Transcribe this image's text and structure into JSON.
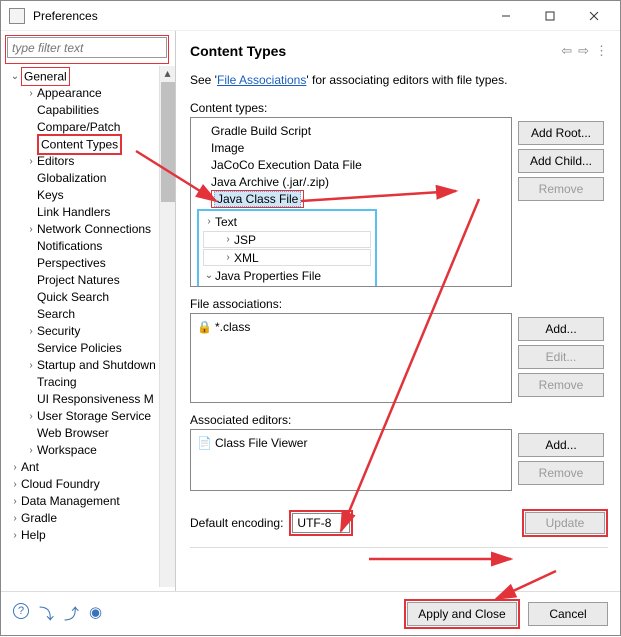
{
  "window": {
    "title": "Preferences"
  },
  "sidebar": {
    "filter_placeholder": "type filter text",
    "nodes": [
      {
        "label": "General",
        "expanded": true,
        "children": [
          "Appearance",
          "Capabilities",
          "Compare/Patch",
          "Content Types",
          "Editors",
          "Globalization",
          "Keys",
          "Link Handlers",
          "Network Connections",
          "Notifications",
          "Perspectives",
          "Project Natures",
          "Quick Search",
          "Search",
          "Security",
          "Service Policies",
          "Startup and Shutdown",
          "Tracing",
          "UI Responsiveness M",
          "User Storage Service",
          "Web Browser",
          "Workspace"
        ]
      },
      {
        "label": "Ant",
        "expanded": false
      },
      {
        "label": "Cloud Foundry",
        "expanded": false
      },
      {
        "label": "Data Management",
        "expanded": false
      },
      {
        "label": "Gradle",
        "expanded": false
      },
      {
        "label": "Help",
        "expanded": false
      }
    ],
    "selected_child": "Content Types"
  },
  "page": {
    "title": "Content Types",
    "intro_prefix": "See '",
    "intro_link": "File Associations",
    "intro_suffix": "' for associating editors with file types.",
    "content_types_label": "Content types:",
    "content_tree": {
      "items": [
        "Gradle Build Script",
        "Image",
        "JaCoCo Execution Data File",
        "Java Archive (.jar/.zip)",
        "Java Class File"
      ],
      "selected": "Java Class File",
      "text_node": {
        "label": "Text",
        "expanded": false,
        "children": [
          "JSP",
          "XML"
        ],
        "last": {
          "label": "Java Properties File",
          "expanded": true
        }
      }
    },
    "buttons_ct": {
      "add_root": "Add Root...",
      "add_child": "Add Child...",
      "remove": "Remove"
    },
    "fa_label": "File associations:",
    "fa_items": [
      {
        "locked": true,
        "pattern": "*.class"
      }
    ],
    "buttons_fa": {
      "add": "Add...",
      "edit": "Edit...",
      "remove": "Remove"
    },
    "ae_label": "Associated editors:",
    "ae_items": [
      {
        "name": "Class File Viewer"
      }
    ],
    "buttons_ae": {
      "add": "Add...",
      "remove": "Remove"
    },
    "encoding_label": "Default encoding:",
    "encoding_value": "UTF-8",
    "update_btn": "Update"
  },
  "footer": {
    "apply_close": "Apply and Close",
    "cancel": "Cancel"
  }
}
